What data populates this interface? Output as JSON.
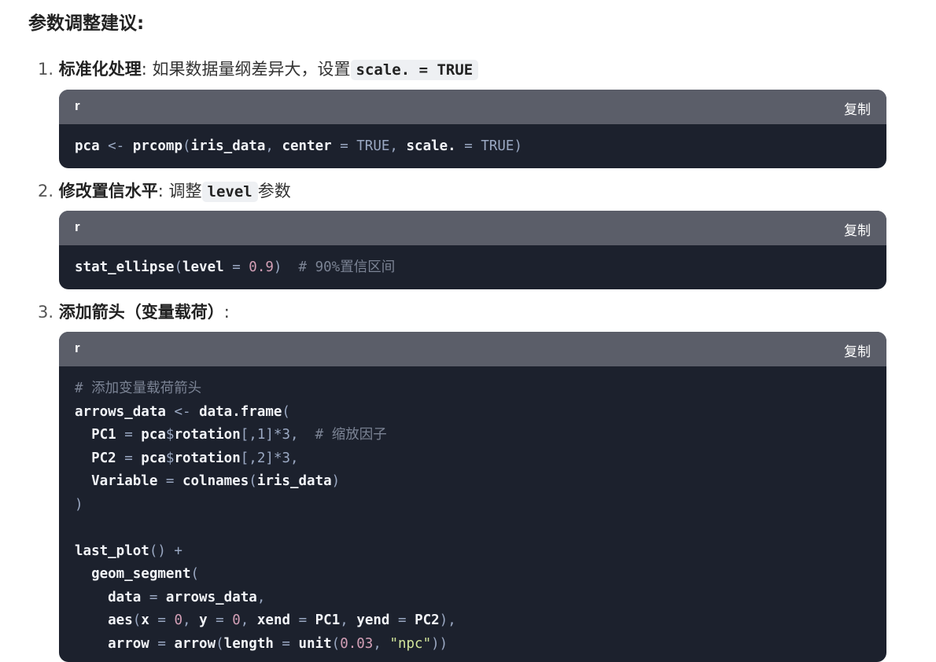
{
  "heading": "参数调整建议:",
  "copy_label": "复制",
  "items": [
    {
      "num": "1.",
      "title": "标准化处理",
      "sep": ":",
      "text": "如果数据量纲差异大，设置",
      "code": "scale. = TRUE",
      "after": ""
    },
    {
      "num": "2.",
      "title": "修改置信水平",
      "sep": ":",
      "text": "调整",
      "code": "level",
      "after": "参数"
    },
    {
      "num": "3.",
      "title": "添加箭头（变量载荷）",
      "sep": ":",
      "text": "",
      "code": "",
      "after": ""
    }
  ],
  "blocks": [
    {
      "lang": "r"
    },
    {
      "lang": "r"
    },
    {
      "lang": "r"
    }
  ],
  "code1": {
    "a": "pca",
    "b": " <- ",
    "c": "prcomp",
    "d": "(",
    "e": "iris_data",
    "f": ", ",
    "g": "center",
    "h": " = ",
    "i": "TRUE",
    "j": ", ",
    "k": "scale.",
    "l": " = ",
    "m": "TRUE",
    "n": ")"
  },
  "code2": {
    "a": "stat_ellipse",
    "b": "(",
    "c": "level",
    "d": " = ",
    "e": "0.9",
    "f": ")",
    "g": "  # 90%置信区间"
  },
  "code3": {
    "l1": "# 添加变量载荷箭头",
    "l2a": "arrows_data",
    "l2b": " <- ",
    "l2c": "data.frame",
    "l2d": "(",
    "l3a": "  PC1",
    "l3b": " = ",
    "l3c": "pca",
    "l3d": "$",
    "l3e": "rotation",
    "l3f": "[,",
    "l3g": "1",
    "l3h": "]*",
    "l3i": "3",
    "l3j": ",",
    "l3k": "  # 缩放因子",
    "l4a": "  PC2",
    "l4b": " = ",
    "l4c": "pca",
    "l4d": "$",
    "l4e": "rotation",
    "l4f": "[,",
    "l4g": "2",
    "l4h": "]*",
    "l4i": "3",
    "l4j": ",",
    "l5a": "  Variable",
    "l5b": " = ",
    "l5c": "colnames",
    "l5d": "(",
    "l5e": "iris_data",
    "l5f": ")",
    "l6": ")",
    "l8a": "last_plot",
    "l8b": "() +",
    "l9a": "  geom_segment",
    "l9b": "(",
    "l10a": "    data",
    "l10b": " = ",
    "l10c": "arrows_data",
    "l10d": ",",
    "l11a": "    aes",
    "l11b": "(",
    "l11c": "x",
    "l11d": " = ",
    "l11e": "0",
    "l11f": ", ",
    "l11g": "y",
    "l11h": " = ",
    "l11i": "0",
    "l11j": ", ",
    "l11k": "xend",
    "l11l": " = ",
    "l11m": "PC1",
    "l11n": ", ",
    "l11o": "yend",
    "l11p": " = ",
    "l11q": "PC2",
    "l11r": "),",
    "l12a": "    arrow",
    "l12b": " = ",
    "l12c": "arrow",
    "l12d": "(",
    "l12e": "length",
    "l12f": " = ",
    "l12g": "unit",
    "l12h": "(",
    "l12i": "0.03",
    "l12j": ", ",
    "l12k": "\"npc\"",
    "l12l": "))"
  }
}
